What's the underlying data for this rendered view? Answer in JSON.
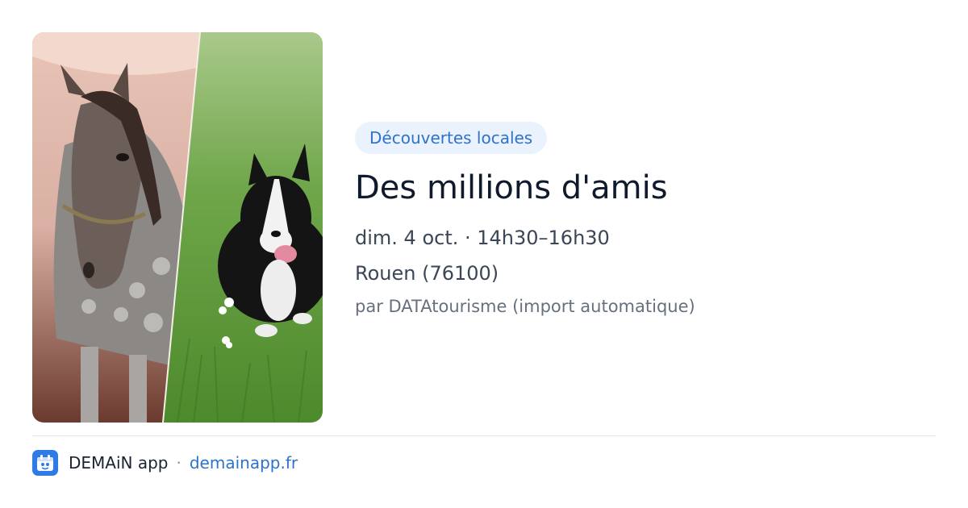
{
  "event": {
    "category": "Découvertes locales",
    "title": "Des millions d'amis",
    "datetime": "dim. 4 oct. · 14h30–16h30",
    "location": "Rouen (76100)",
    "source": "par DATAtourisme (import automatique)"
  },
  "footer": {
    "app_name": "DEMAiN app",
    "separator": "·",
    "link": "demainapp.fr"
  },
  "colors": {
    "accent": "#2f73c9",
    "badge_bg": "#eaf2fd",
    "app_icon_bg": "#2d7be5"
  },
  "icons": {
    "app": "demain-app-icon"
  }
}
